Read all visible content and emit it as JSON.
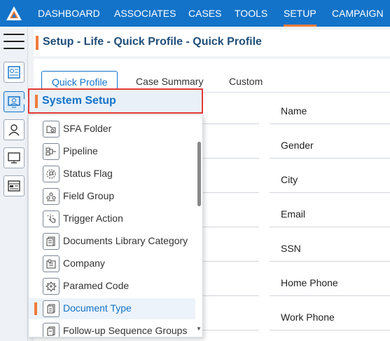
{
  "nav": {
    "items": [
      {
        "label": "DASHBOARD"
      },
      {
        "label": "ASSOCIATES"
      },
      {
        "label": "CASES"
      },
      {
        "label": "TOOLS"
      },
      {
        "label": "SETUP",
        "active": true
      },
      {
        "label": "CAMPAIGN"
      }
    ]
  },
  "page": {
    "title": "Setup - Life - Quick Profile - Quick Profile"
  },
  "tabs": [
    {
      "label": "Quick Profile",
      "active": true
    },
    {
      "label": "Case Summary"
    },
    {
      "label": "Custom"
    }
  ],
  "fields": [
    "Name",
    "Gender",
    "City",
    "Email",
    "SSN",
    "Home Phone",
    "Work Phone"
  ],
  "menu": {
    "title": "System Setup",
    "items": [
      {
        "label": "SFA Folder",
        "icon": "folder-icon"
      },
      {
        "label": "Pipeline",
        "icon": "pipeline-icon"
      },
      {
        "label": "Status Flag",
        "icon": "status-flag-icon"
      },
      {
        "label": "Field Group",
        "icon": "field-group-icon"
      },
      {
        "label": "Trigger Action",
        "icon": "trigger-action-icon"
      },
      {
        "label": "Documents Library Category",
        "icon": "documents-library-icon"
      },
      {
        "label": "Company",
        "icon": "company-icon"
      },
      {
        "label": "Paramed Code",
        "icon": "paramed-code-icon"
      },
      {
        "label": "Document Type",
        "icon": "document-type-icon",
        "active": true
      },
      {
        "label": "Follow-up Sequence Groups",
        "icon": "follow-up-sequence-icon"
      }
    ]
  },
  "colors": {
    "brand_blue": "#1273c9",
    "accent_orange": "#f07c3a",
    "highlight_red": "#e53935"
  }
}
